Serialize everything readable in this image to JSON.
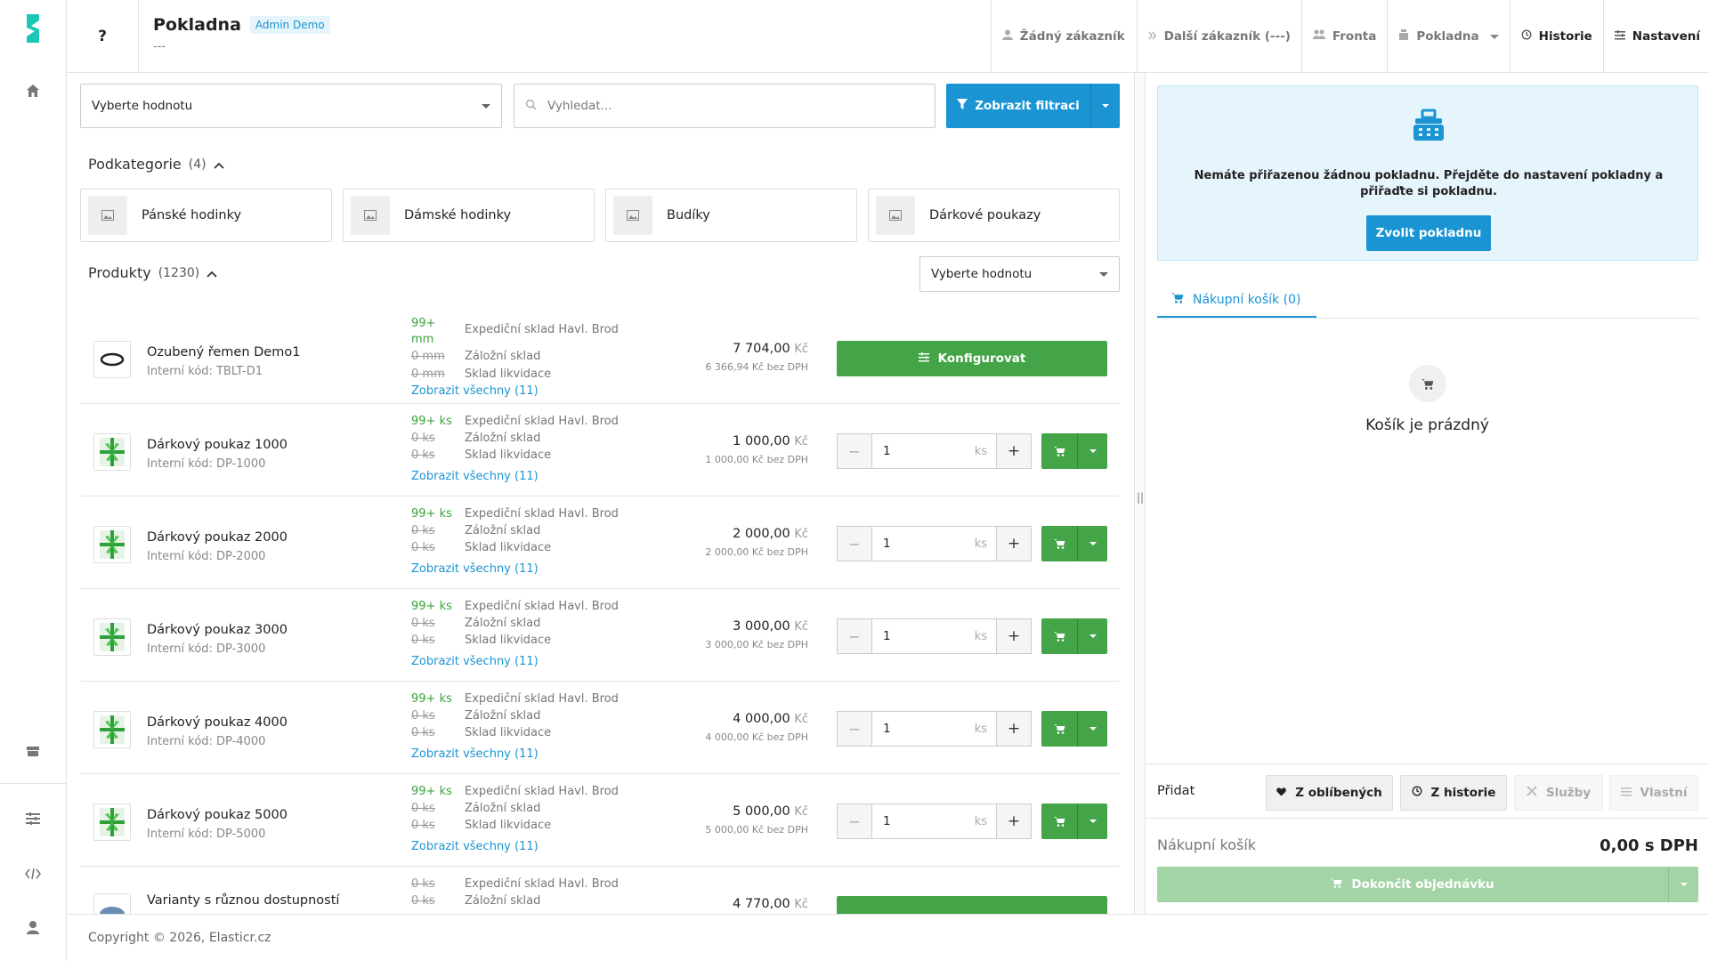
{
  "header": {
    "help_label": "?",
    "title": "Pokladna",
    "badge": "Admin Demo",
    "subtitle": "---",
    "nav": [
      {
        "label": "Žádný zákazník",
        "icon": "user-icon"
      },
      {
        "label": "Další zákazník (---)",
        "icon": "double-chevron-icon"
      },
      {
        "label": "Fronta",
        "icon": "users-icon"
      },
      {
        "label": "Pokladna",
        "icon": "register-icon"
      },
      {
        "label": "Historie",
        "icon": "history-icon"
      },
      {
        "label": "Nastavení",
        "icon": "sliders-icon"
      }
    ]
  },
  "filters": {
    "select_placeholder": "Vyberte hodnotu",
    "search_placeholder": "Vyhledat...",
    "filter_button": "Zobrazit filtraci"
  },
  "subcategories": {
    "title": "Podkategorie",
    "count": "(4)",
    "items": [
      "Pánské hodinky",
      "Dámské hodinky",
      "Budíky",
      "Dárkové poukazy"
    ]
  },
  "products": {
    "title": "Produkty",
    "count": "(1230)",
    "sort_placeholder": "Vyberte hodnotu",
    "show_all": "Zobrazit všechny (11)",
    "currency": "Kč",
    "unit": "ks",
    "items": [
      {
        "name": "Ozubený řemen Demo1",
        "code": "Interní kód: TBLT-D1",
        "stock": [
          {
            "q": "99+ mm",
            "w": "Expediční sklad Havl. Brod"
          },
          {
            "q": "0 mm",
            "w": "Záložní sklad"
          },
          {
            "q": "0 mm",
            "w": "Sklad likvidace"
          }
        ],
        "price": "7 704,00",
        "net": "6 366,94 Kč bez DPH",
        "action": "Konfigurovat"
      },
      {
        "name": "Dárkový poukaz 1000",
        "code": "Interní kód: DP-1000",
        "stock": [
          {
            "q": "99+ ks",
            "w": "Expediční sklad Havl. Brod"
          },
          {
            "q": "0 ks",
            "w": "Záložní sklad"
          },
          {
            "q": "0 ks",
            "w": "Sklad likvidace"
          }
        ],
        "price": "1 000,00",
        "net": "1 000,00 Kč bez DPH",
        "qty": "1"
      },
      {
        "name": "Dárkový poukaz 2000",
        "code": "Interní kód: DP-2000",
        "stock": [
          {
            "q": "99+ ks",
            "w": "Expediční sklad Havl. Brod"
          },
          {
            "q": "0 ks",
            "w": "Záložní sklad"
          },
          {
            "q": "0 ks",
            "w": "Sklad likvidace"
          }
        ],
        "price": "2 000,00",
        "net": "2 000,00 Kč bez DPH",
        "qty": "1"
      },
      {
        "name": "Dárkový poukaz 3000",
        "code": "Interní kód: DP-3000",
        "stock": [
          {
            "q": "99+ ks",
            "w": "Expediční sklad Havl. Brod"
          },
          {
            "q": "0 ks",
            "w": "Záložní sklad"
          },
          {
            "q": "0 ks",
            "w": "Sklad likvidace"
          }
        ],
        "price": "3 000,00",
        "net": "3 000,00 Kč bez DPH",
        "qty": "1"
      },
      {
        "name": "Dárkový poukaz 4000",
        "code": "Interní kód: DP-4000",
        "stock": [
          {
            "q": "99+ ks",
            "w": "Expediční sklad Havl. Brod"
          },
          {
            "q": "0 ks",
            "w": "Záložní sklad"
          },
          {
            "q": "0 ks",
            "w": "Sklad likvidace"
          }
        ],
        "price": "4 000,00",
        "net": "4 000,00 Kč bez DPH",
        "qty": "1"
      },
      {
        "name": "Dárkový poukaz 5000",
        "code": "Interní kód: DP-5000",
        "stock": [
          {
            "q": "99+ ks",
            "w": "Expediční sklad Havl. Brod"
          },
          {
            "q": "0 ks",
            "w": "Záložní sklad"
          },
          {
            "q": "0 ks",
            "w": "Sklad likvidace"
          }
        ],
        "price": "5 000,00",
        "net": "5 000,00 Kč bez DPH",
        "qty": "1"
      },
      {
        "name": "Varianty s různou dostupností",
        "stock": [
          {
            "q": "0 ks",
            "w": "Expediční sklad Havl. Brod"
          },
          {
            "q": "0 ks",
            "w": "Záložní sklad"
          }
        ],
        "price": "4 770,00"
      }
    ]
  },
  "register": {
    "alert": "Nemáte přiřazenou žádnou pokladnu. Přejděte do nastavení pokladny a přiřaďte si pokladnu.",
    "choose_button": "Zvolit pokladnu"
  },
  "cart": {
    "tab": "Nákupní košík (0)",
    "empty": "Košík je prázdný",
    "add_label": "Přidat",
    "add_buttons": [
      "Z oblíbených",
      "Z historie",
      "Služby",
      "Vlastní"
    ],
    "total_label": "Nákupní košík",
    "total_value": "0,00 s DPH",
    "finish": "Dokončit objednávku"
  },
  "footer": {
    "copyright": "Copyright © 2026, Elasticr.cz"
  },
  "colors": {
    "accent": "#1a94d3",
    "success": "#43a547",
    "logo": "#1ec6b6"
  }
}
